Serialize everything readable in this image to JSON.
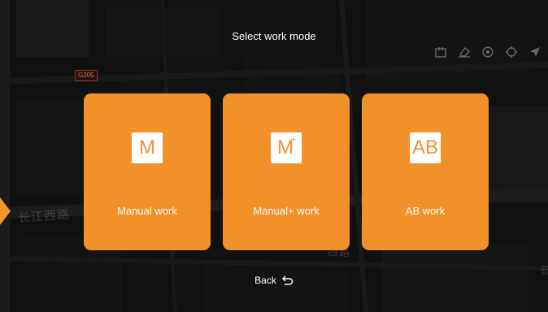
{
  "header": {
    "title": "Select work mode"
  },
  "map": {
    "road_badge": "G205",
    "street_left": "长江西路",
    "street_mid": "西路",
    "street_right": "长"
  },
  "modes": [
    {
      "icon_text": "M",
      "icon_sup": "",
      "label": "Manual work"
    },
    {
      "icon_text": "M",
      "icon_sup": "+",
      "label": "Manual+ work"
    },
    {
      "icon_text": "AB",
      "icon_sup": "",
      "label": "AB work"
    }
  ],
  "footer": {
    "back_label": "Back"
  },
  "colors": {
    "accent": "#f2902a",
    "text": "#ffffff"
  }
}
